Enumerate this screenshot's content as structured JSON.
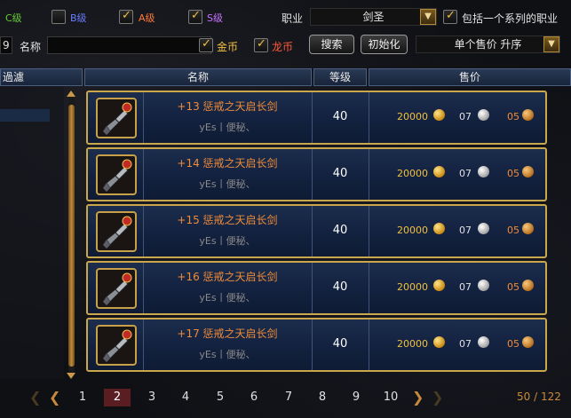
{
  "filters": {
    "grades": [
      {
        "label": "C级",
        "color": "#66cc33",
        "checked": false
      },
      {
        "label": "B级",
        "color": "#6a7cff",
        "checked": false
      },
      {
        "label": "A级",
        "color": "#ff7a3a",
        "checked": true
      },
      {
        "label": "S级",
        "color": "#c873ff",
        "checked": true
      }
    ],
    "job_label": "职业",
    "job_value": "剑圣",
    "include_series_label": "包括一个系列的职业",
    "include_series_checked": true,
    "level_value_fragment": "9",
    "name_label": "名称",
    "name_value": "",
    "gold_label": "金币",
    "gold_checked": true,
    "dragon_label": "龙币",
    "dragon_checked": true,
    "search_button": "搜索",
    "reset_button": "初始化",
    "sort_value": "单个售价 升序"
  },
  "table": {
    "headers": {
      "filter": "過濾",
      "name": "名称",
      "level": "等级",
      "price": "售价"
    },
    "rows": [
      {
        "name": "+13 惩戒之天启长剑",
        "seller": "yEs丨便秘、",
        "level": "40",
        "gold": "20000",
        "silver": "07",
        "bronze": "05"
      },
      {
        "name": "+14 惩戒之天启长剑",
        "seller": "yEs丨便秘、",
        "level": "40",
        "gold": "20000",
        "silver": "07",
        "bronze": "05"
      },
      {
        "name": "+15 惩戒之天启长剑",
        "seller": "yEs丨便秘、",
        "level": "40",
        "gold": "20000",
        "silver": "07",
        "bronze": "05"
      },
      {
        "name": "+16 惩戒之天启长剑",
        "seller": "yEs丨便秘、",
        "level": "40",
        "gold": "20000",
        "silver": "07",
        "bronze": "05"
      },
      {
        "name": "+17 惩戒之天启长剑",
        "seller": "yEs丨便秘、",
        "level": "40",
        "gold": "20000",
        "silver": "07",
        "bronze": "05"
      }
    ]
  },
  "pagination": {
    "pages": [
      "1",
      "2",
      "3",
      "4",
      "5",
      "6",
      "7",
      "8",
      "9",
      "10"
    ],
    "current": "2",
    "count": "50 / 122"
  },
  "icons": {
    "dropdown": "chevron-down-icon",
    "checkbox": "checkmark-icon",
    "item": "sword-icon",
    "gold": "gold-coin-icon",
    "silver": "silver-coin-icon",
    "bronze": "bronze-coin-icon"
  }
}
